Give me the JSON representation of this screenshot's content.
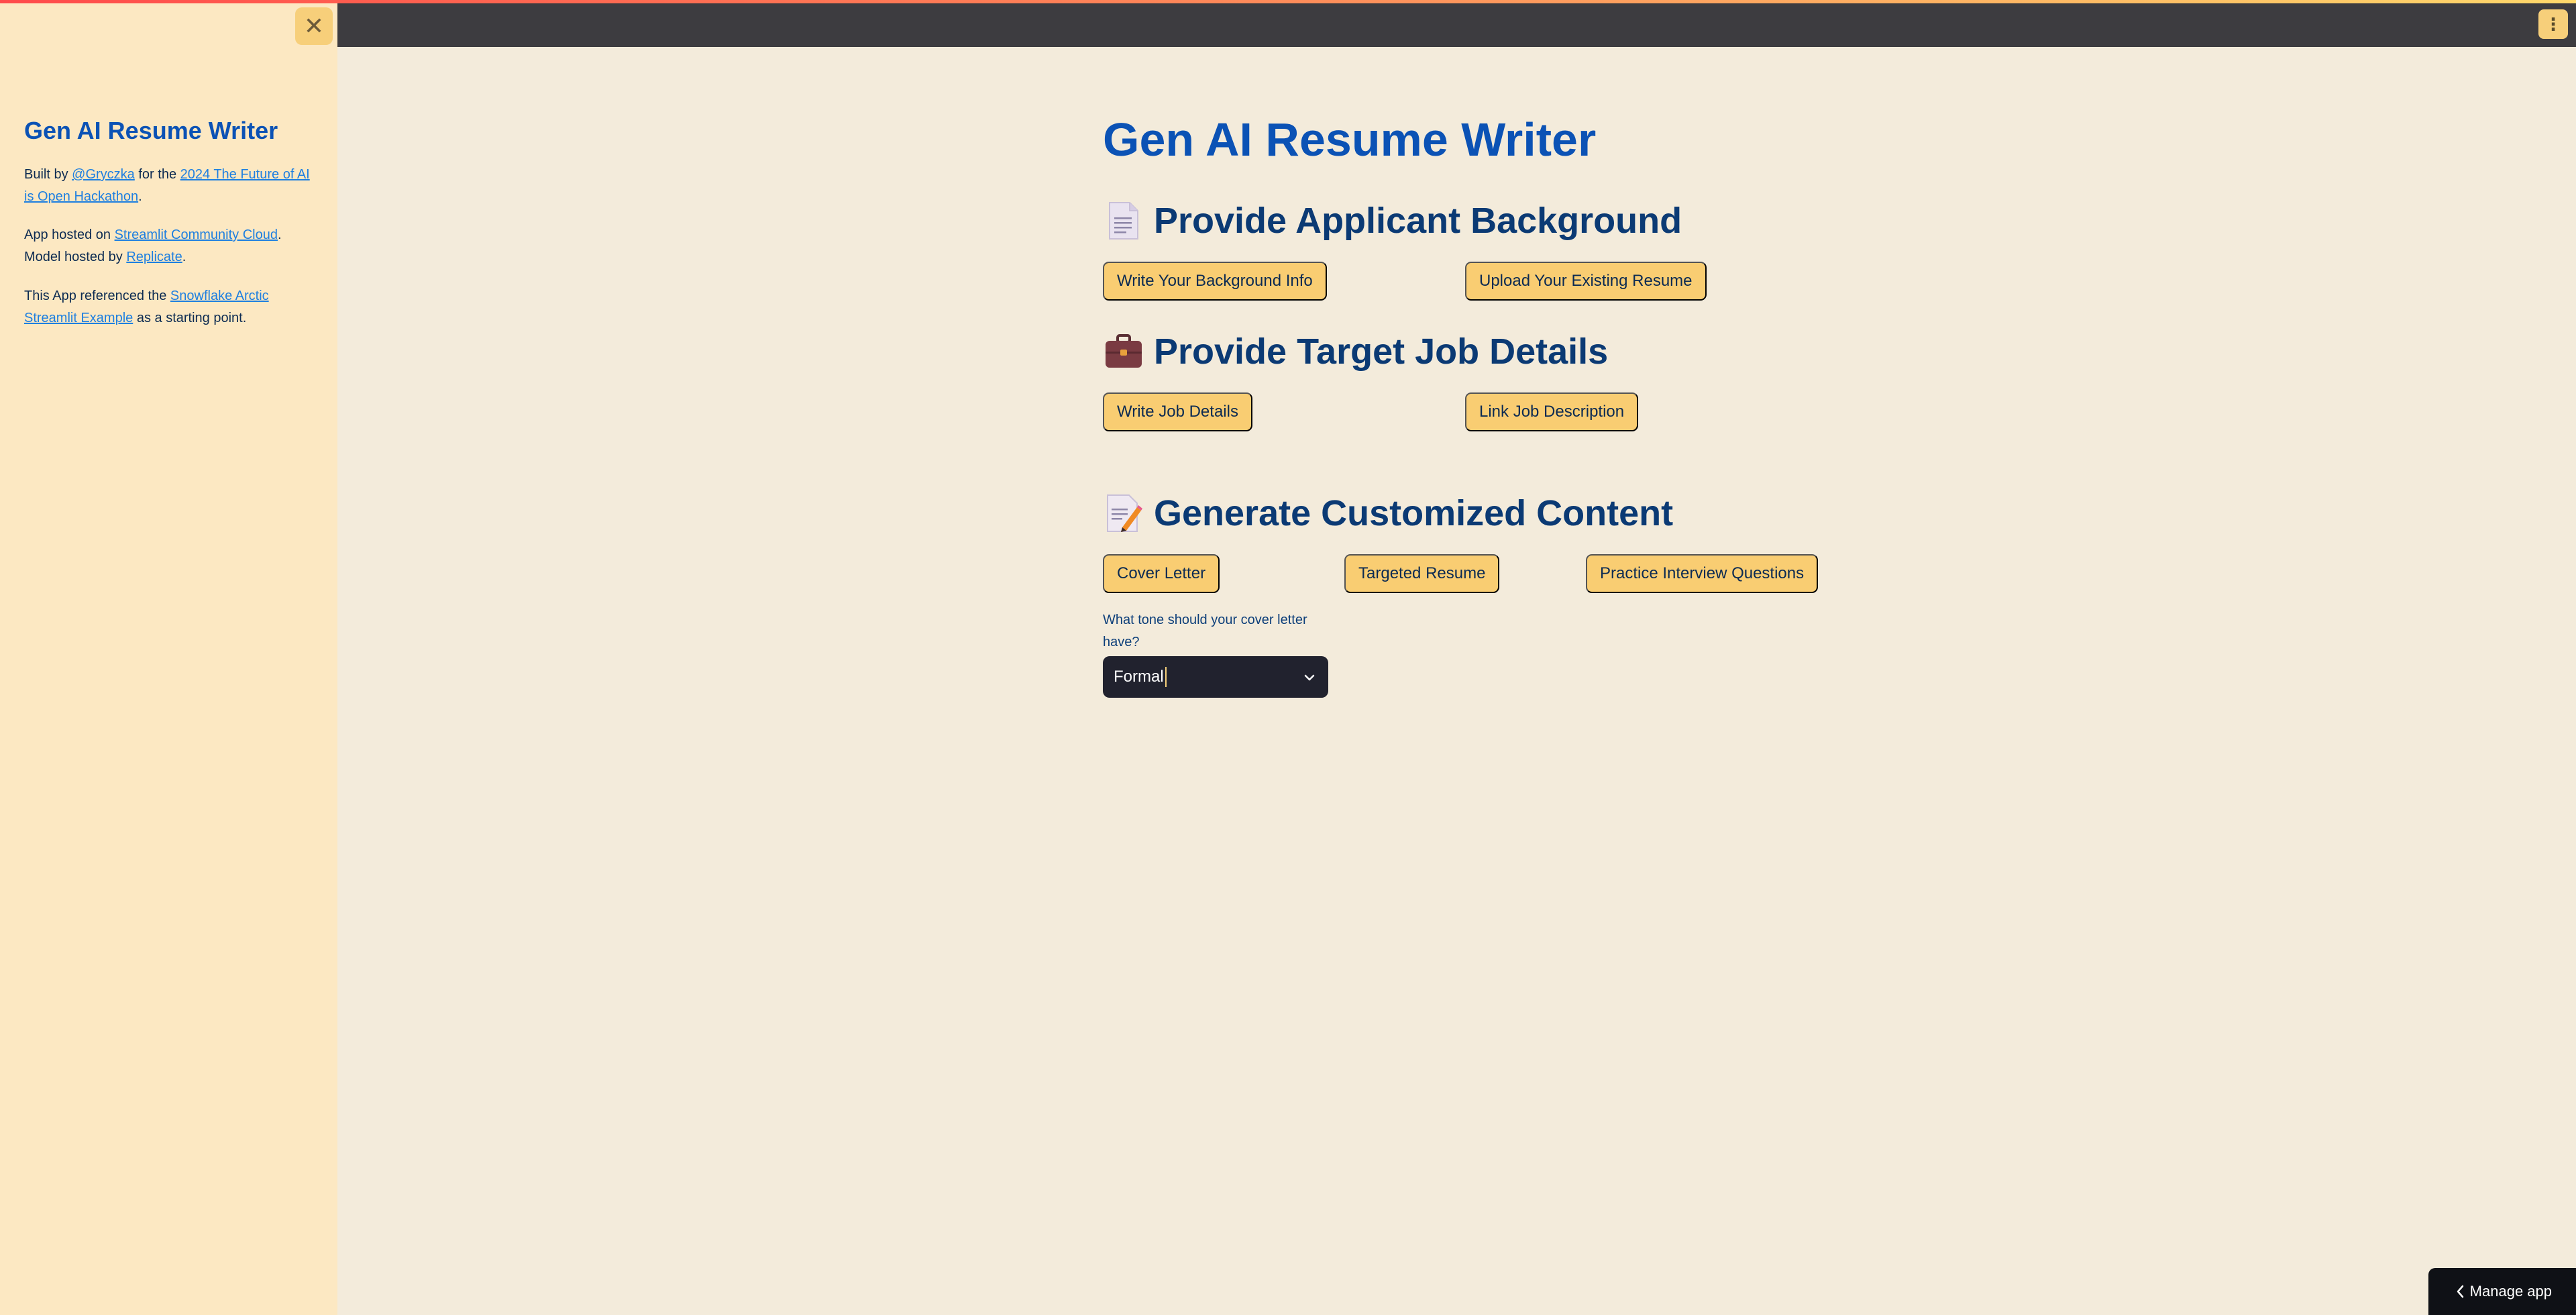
{
  "sidebar": {
    "title": "Gen AI Resume Writer",
    "close_icon": "close-icon",
    "p1": {
      "pre": "Built by ",
      "link1": "@Gryczka",
      "mid": " for the ",
      "link2": "2024 The Future of AI is Open Hackathon",
      "post": "."
    },
    "p2": {
      "pre": "App hosted on ",
      "link1": "Streamlit Community Cloud",
      "mid": ". Model hosted by ",
      "link2": "Replicate",
      "post": "."
    },
    "p3": {
      "pre": "This App referenced the ",
      "link1": "Snowflake Arctic Streamlit Example",
      "post": " as a starting point."
    }
  },
  "header": {
    "menu_icon": "more-vertical-icon"
  },
  "main": {
    "title": "Gen AI Resume Writer",
    "section1": {
      "heading": "Provide Applicant Background",
      "icon": "document-icon",
      "buttons": [
        "Write Your Background Info",
        "Upload Your Existing Resume"
      ]
    },
    "section2": {
      "heading": "Provide Target Job Details",
      "icon": "briefcase-icon",
      "buttons": [
        "Write Job Details",
        "Link Job Description"
      ]
    },
    "section3": {
      "heading": "Generate Customized Content",
      "icon": "memo-icon",
      "buttons": [
        "Cover Letter",
        "Targeted Resume",
        "Practice Interview Questions"
      ]
    },
    "tone": {
      "label": "What tone should your cover letter have?",
      "value": "Formal"
    }
  },
  "footer": {
    "manage_label": "Manage app"
  },
  "colors": {
    "accent": "#f9cd72",
    "title_blue": "#0b52b5",
    "sidebar_bg": "#fce8c2",
    "main_bg": "#f3ebdb",
    "header_bg": "#3d3c40"
  }
}
